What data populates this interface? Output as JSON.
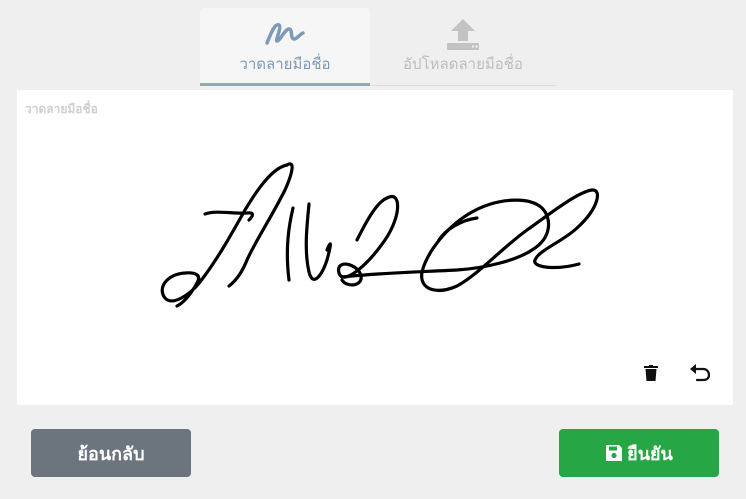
{
  "tabs": [
    {
      "label": "วาดลายมือชื่อ",
      "active": true,
      "icon": "signature-icon"
    },
    {
      "label": "อัปโหลดลายมือชื่อ",
      "active": false,
      "icon": "upload-icon"
    }
  ],
  "pad": {
    "label": "วาดลายมือชื่อ",
    "tools": [
      "trash-icon",
      "undo-icon"
    ]
  },
  "buttons": {
    "back_label": "ย้อนกลับ",
    "confirm_label": "ยืนยัน"
  },
  "colors": {
    "active_tab": "#7f9ab8",
    "back_button": "#6c747e",
    "confirm_button": "#27a645"
  }
}
